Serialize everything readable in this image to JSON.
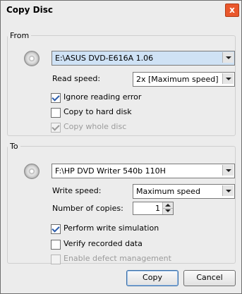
{
  "window": {
    "title": "Copy Disc",
    "close_icon": "x"
  },
  "from": {
    "legend": "From",
    "drive": "E:\\ASUS DVD-E616A 1.06",
    "read_speed_label": "Read speed:",
    "read_speed_value": "2x [Maximum speed]",
    "options": [
      {
        "label": "Ignore reading error",
        "checked": true,
        "enabled": true
      },
      {
        "label": "Copy to hard disk",
        "checked": false,
        "enabled": true
      },
      {
        "label": "Copy whole disc",
        "checked": true,
        "enabled": false
      }
    ]
  },
  "to": {
    "legend": "To",
    "drive": "F:\\HP DVD Writer 540b 110H",
    "write_speed_label": "Write speed:",
    "write_speed_value": "Maximum speed",
    "copies_label": "Number of copies:",
    "copies_value": "1",
    "options": [
      {
        "label": "Perform write simulation",
        "checked": true,
        "enabled": true
      },
      {
        "label": "Verify recorded data",
        "checked": false,
        "enabled": true
      },
      {
        "label": "Enable defect management",
        "checked": false,
        "enabled": false
      }
    ]
  },
  "buttons": {
    "copy": "Copy",
    "cancel": "Cancel"
  }
}
